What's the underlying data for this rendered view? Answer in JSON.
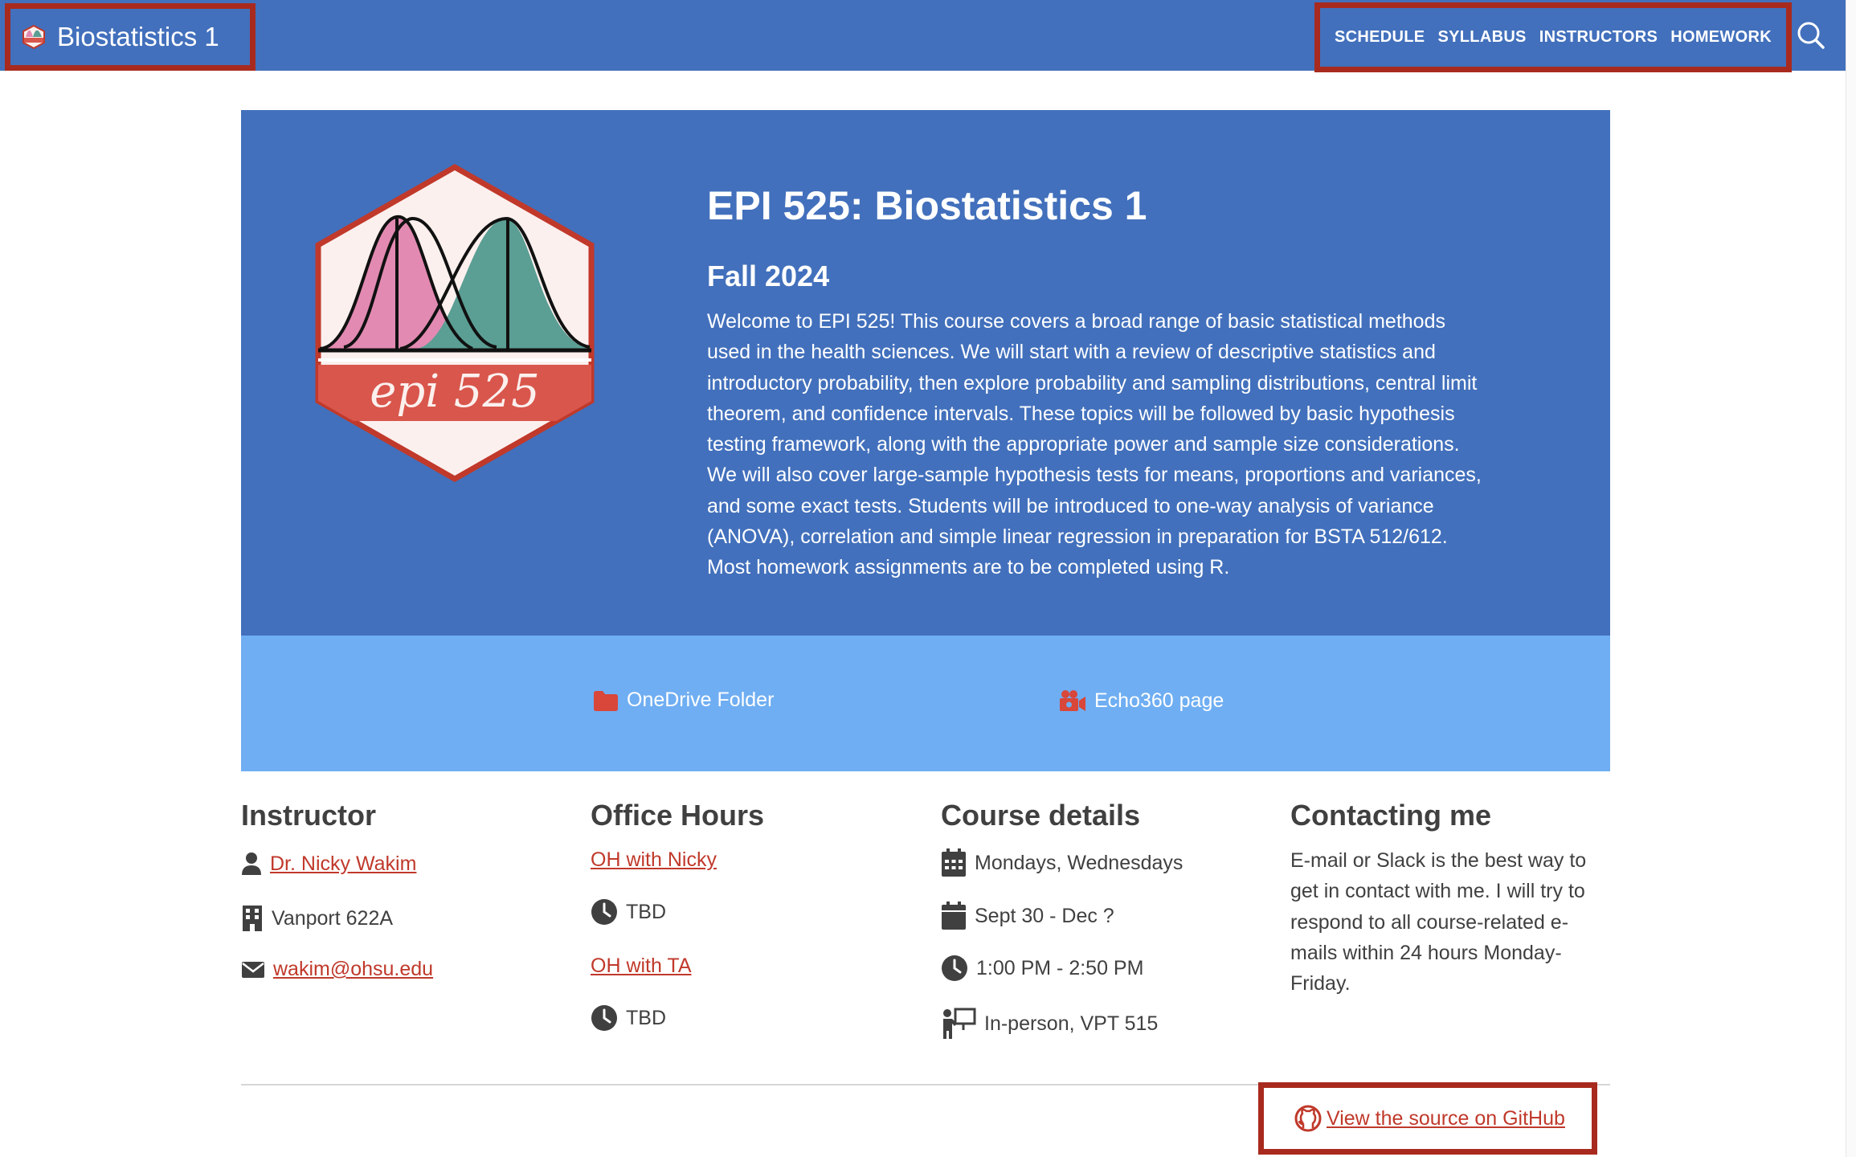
{
  "navbar": {
    "brand_title": "Biostatistics 1",
    "links": [
      "SCHEDULE",
      "SYLLABUS",
      "INSTRUCTORS",
      "HOMEWORK"
    ],
    "background": "#4270bc"
  },
  "hero": {
    "logo_text": "epi 525",
    "title": "EPI 525: Biostatistics 1",
    "subtitle": "Fall 2024",
    "description": "Welcome to EPI 525! This course covers a broad range of basic statistical methods used in the health sciences. We will start with a review of descriptive statistics and introductory probability, then explore probability and sampling distributions, central limit theorem, and confidence intervals. These topics will be followed by basic hypothesis testing framework, along with the appropriate power and sample size considerations. We will also cover large-sample hypothesis tests for means, proportions and variances, and some exact tests. Students will be introduced to one-way analysis of variance (ANOVA), correlation and simple linear regression in preparation for BSTA 512/612. Most homework assignments are to be completed using R."
  },
  "resources": {
    "onedrive": "OneDrive Folder",
    "echo360": "Echo360 page"
  },
  "instructor": {
    "heading": "Instructor",
    "name": "Dr. Nicky Wakim",
    "office": "Vanport 622A",
    "email": "wakim@ohsu.edu"
  },
  "office_hours": {
    "heading": "Office Hours",
    "oh1_label": "OH with Nicky",
    "oh1_time": "TBD",
    "oh2_label": "OH with TA",
    "oh2_time": "TBD"
  },
  "course_details": {
    "heading": "Course details",
    "days": "Mondays, Wednesdays",
    "dates": "Sept 30 - Dec ?",
    "time": "1:00 PM - 2:50 PM",
    "location": "In-person, VPT 515"
  },
  "contact": {
    "heading": "Contacting me",
    "text": "E-mail or Slack is the best way to get in contact with me. I will try to respond to all course-related e-mails within 24 hours Monday-Friday."
  },
  "footer": {
    "github_link": "View the source on GitHub"
  },
  "colors": {
    "accent_red": "#c0392b",
    "highlight_border": "#a82a1e",
    "band_blue": "#6faef2"
  }
}
